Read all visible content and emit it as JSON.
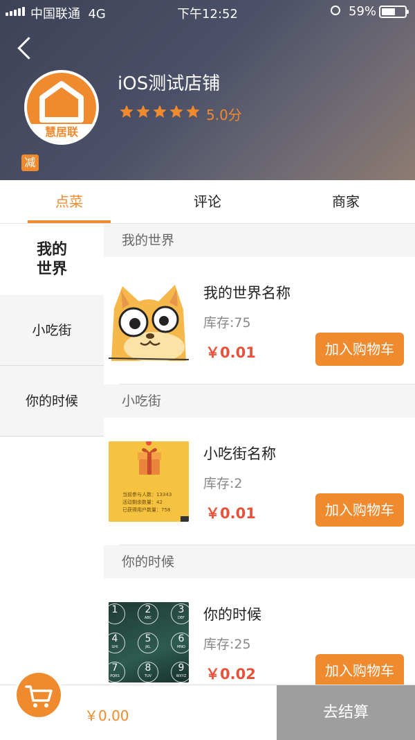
{
  "status_bar": {
    "carrier": "中国联通",
    "network": "4G",
    "time": "下午12:52",
    "battery_pct": "59%",
    "battery_level": 0.59
  },
  "shop": {
    "name": "iOS测试店铺",
    "logo_text": "慧居联",
    "rating_text": "5.0分",
    "stars": 5,
    "promo_badge": "减"
  },
  "tabs": [
    {
      "label": "点菜",
      "active": true
    },
    {
      "label": "评论",
      "active": false
    },
    {
      "label": "商家",
      "active": false
    }
  ],
  "categories": [
    {
      "label": "我的世界",
      "active": true
    },
    {
      "label": "小吃街",
      "active": false
    },
    {
      "label": "你的时候",
      "active": false
    }
  ],
  "sections": [
    {
      "header": "我的世界",
      "item": {
        "name": "我的世界名称",
        "stock": "库存:75",
        "price": "￥0.01",
        "button": "加入购物车",
        "image": "cartoon-cat"
      }
    },
    {
      "header": "小吃街",
      "item": {
        "name": "小吃街名称",
        "stock": "库存:2",
        "price": "￥0.01",
        "button": "加入购物车",
        "image": "gift-box-poster",
        "image_lines": [
          "当前参与人数：13343",
          "活动剩余数量：42",
          "已获得用户数量：758"
        ]
      }
    },
    {
      "header": "你的时候",
      "item": {
        "name": "你的时候",
        "stock": "库存:25",
        "price": "￥0.02",
        "button": "加入购物车",
        "image": "passcode-keypad",
        "image_keys": [
          "1",
          "2",
          "3",
          "4",
          "5",
          "6",
          "7",
          "8",
          "9"
        ],
        "image_subs": [
          "",
          "ABC",
          "DEF",
          "GHI",
          "JKL",
          "MNO",
          "PQRS",
          "TUV",
          "WXYZ"
        ]
      }
    }
  ],
  "bottom_bar": {
    "total": "￥0.00",
    "checkout": "去结算"
  },
  "colors": {
    "accent": "#f08a2f",
    "price": "#e8523a",
    "checkout_bg": "#9e9e9e"
  }
}
